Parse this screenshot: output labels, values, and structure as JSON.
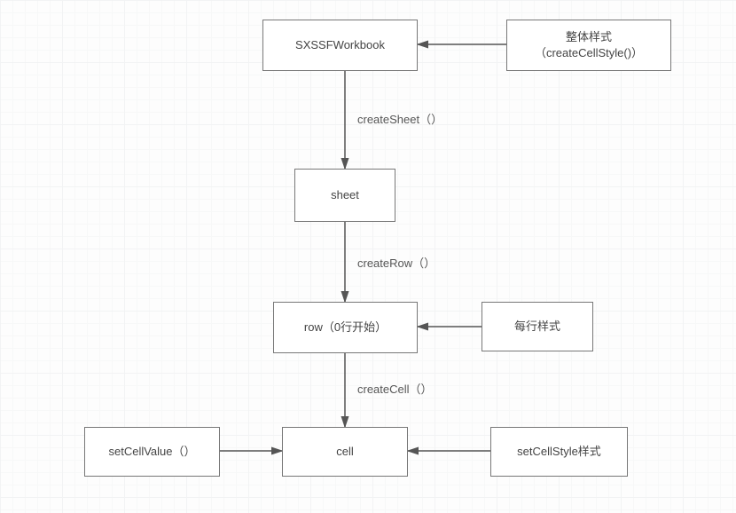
{
  "nodes": {
    "workbook": {
      "label": "SXSSFWorkbook"
    },
    "wb_style": {
      "label": "整体样式\n（createCellStyle()）"
    },
    "sheet": {
      "label": "sheet"
    },
    "row": {
      "label": "row（0行开始）"
    },
    "row_style": {
      "label": "每行样式"
    },
    "cell": {
      "label": "cell"
    },
    "set_value": {
      "label": "setCellValue（）"
    },
    "cell_style": {
      "label": "setCellStyle样式"
    }
  },
  "edges": {
    "create_sheet": {
      "label": "createSheet（）"
    },
    "create_row": {
      "label": "createRow（）"
    },
    "create_cell": {
      "label": "createCell（）"
    }
  }
}
